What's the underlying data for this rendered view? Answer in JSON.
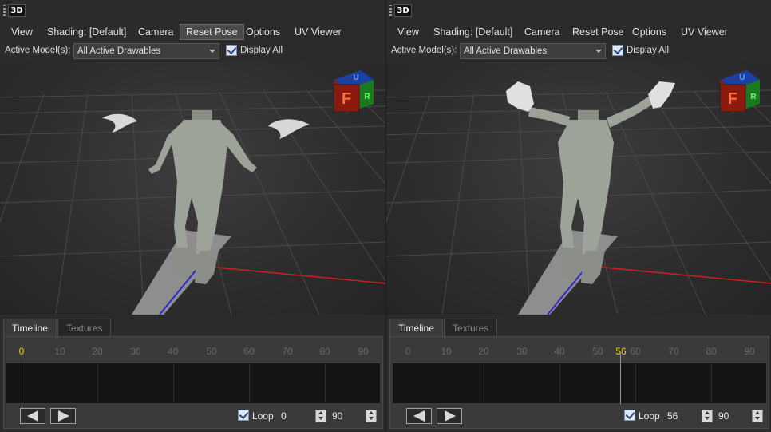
{
  "panels": [
    {
      "app_icon": "3D",
      "menu": [
        "View",
        "Shading: [Default]",
        "Camera",
        "Reset Pose",
        "Options",
        "UV Viewer"
      ],
      "active_menu": "Reset Pose",
      "active_models_label": "Active Model(s):",
      "active_models_value": "All Active Drawables",
      "display_all_label": "Display All",
      "display_all_checked": true,
      "tabs": [
        "Timeline",
        "Textures"
      ],
      "ticks": [
        "0",
        "10",
        "20",
        "30",
        "40",
        "50",
        "60",
        "70",
        "80",
        "90"
      ],
      "current_frame": 0,
      "current_frame_label": "0",
      "loop_label": "Loop",
      "loop_checked": true,
      "frame_field": "0",
      "end_field": "90",
      "pose": "arms-down"
    },
    {
      "app_icon": "3D",
      "menu": [
        "View",
        "Shading: [Default]",
        "Camera",
        "Reset Pose",
        "Options",
        "UV Viewer"
      ],
      "active_menu": "",
      "active_models_label": "Active Model(s):",
      "active_models_value": "All Active Drawables",
      "display_all_label": "Display All",
      "display_all_checked": true,
      "tabs": [
        "Timeline",
        "Textures"
      ],
      "ticks": [
        "0",
        "10",
        "20",
        "30",
        "40",
        "50",
        "60",
        "70",
        "80",
        "90"
      ],
      "current_frame": 56,
      "current_frame_label": "56",
      "loop_label": "Loop",
      "loop_checked": true,
      "frame_field": "56",
      "end_field": "90",
      "pose": "arms-raised"
    }
  ],
  "orientation_cube": {
    "front": "F",
    "top": "U",
    "side": "R"
  },
  "colors": {
    "x_axis": "#d02020",
    "z_axis": "#2a2ad0",
    "cube_front": "#8a1a0e",
    "cube_top": "#1c3fa0",
    "cube_side": "#1a7a1e",
    "playhead_label": "#f0d000"
  },
  "icons": {
    "step_back": "step-back-icon",
    "step_forward": "step-forward-icon",
    "grip": "grip-icon",
    "orientation_cube": "orientation-cube-icon"
  }
}
